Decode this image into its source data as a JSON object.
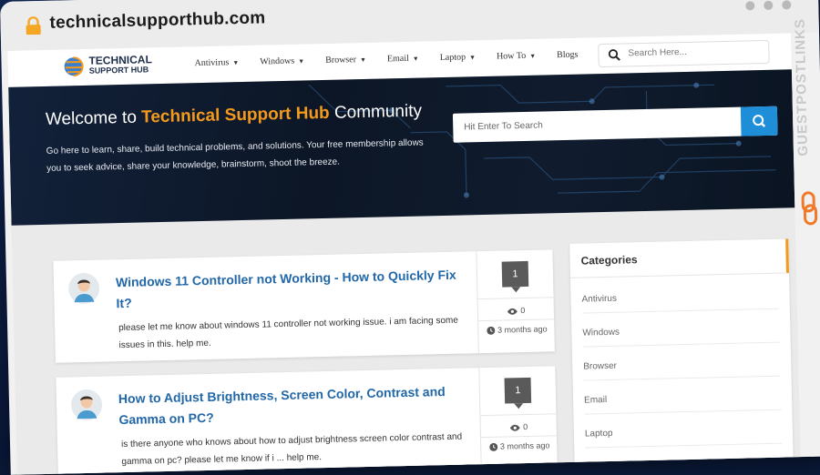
{
  "browser": {
    "url": "technicalsupporthub.com",
    "lock_icon": "lock-icon"
  },
  "site": {
    "logo": {
      "line1": "TECHNICAL",
      "line2": "SUPPORT HUB"
    },
    "nav": [
      {
        "label": "Antivirus",
        "dropdown": true
      },
      {
        "label": "Windows",
        "dropdown": true
      },
      {
        "label": "Browser",
        "dropdown": true
      },
      {
        "label": "Email",
        "dropdown": true
      },
      {
        "label": "Laptop",
        "dropdown": true
      },
      {
        "label": "How To",
        "dropdown": true
      },
      {
        "label": "Blogs",
        "dropdown": false
      }
    ],
    "search_placeholder": "Search Here..."
  },
  "hero": {
    "welcome": "Welcome to",
    "brand": "Technical Support Hub",
    "community": "Community",
    "description": "Go here to learn, share, build technical problems, and solutions. Your free membership allows you to seek advice, share your knowledge, brainstorm, shoot the breeze.",
    "search_placeholder": "Hit Enter To Search"
  },
  "posts": [
    {
      "title": "Windows 11 Controller not Working - How to Quickly Fix It?",
      "excerpt": "please let me know about windows 11 controller not working issue. i am facing some issues in this. help me.",
      "answers": "1",
      "views": "0",
      "time": "3 months ago"
    },
    {
      "title": "How to Adjust Brightness, Screen Color, Contrast and Gamma on PC?",
      "excerpt": "is there anyone who knows about how to adjust brightness screen color contrast and gamma on pc? please let me know if i ... help me.",
      "answers": "1",
      "views": "0",
      "time": "3 months ago"
    }
  ],
  "sidebar": {
    "title": "Categories",
    "items": [
      "Antivirus",
      "Windows",
      "Browser",
      "Email",
      "Laptop"
    ]
  },
  "watermark": {
    "text": "GUESTPOSTLINKS"
  },
  "colors": {
    "accent": "#f39a1d",
    "link": "#2267a8",
    "button": "#1f8ed8"
  }
}
